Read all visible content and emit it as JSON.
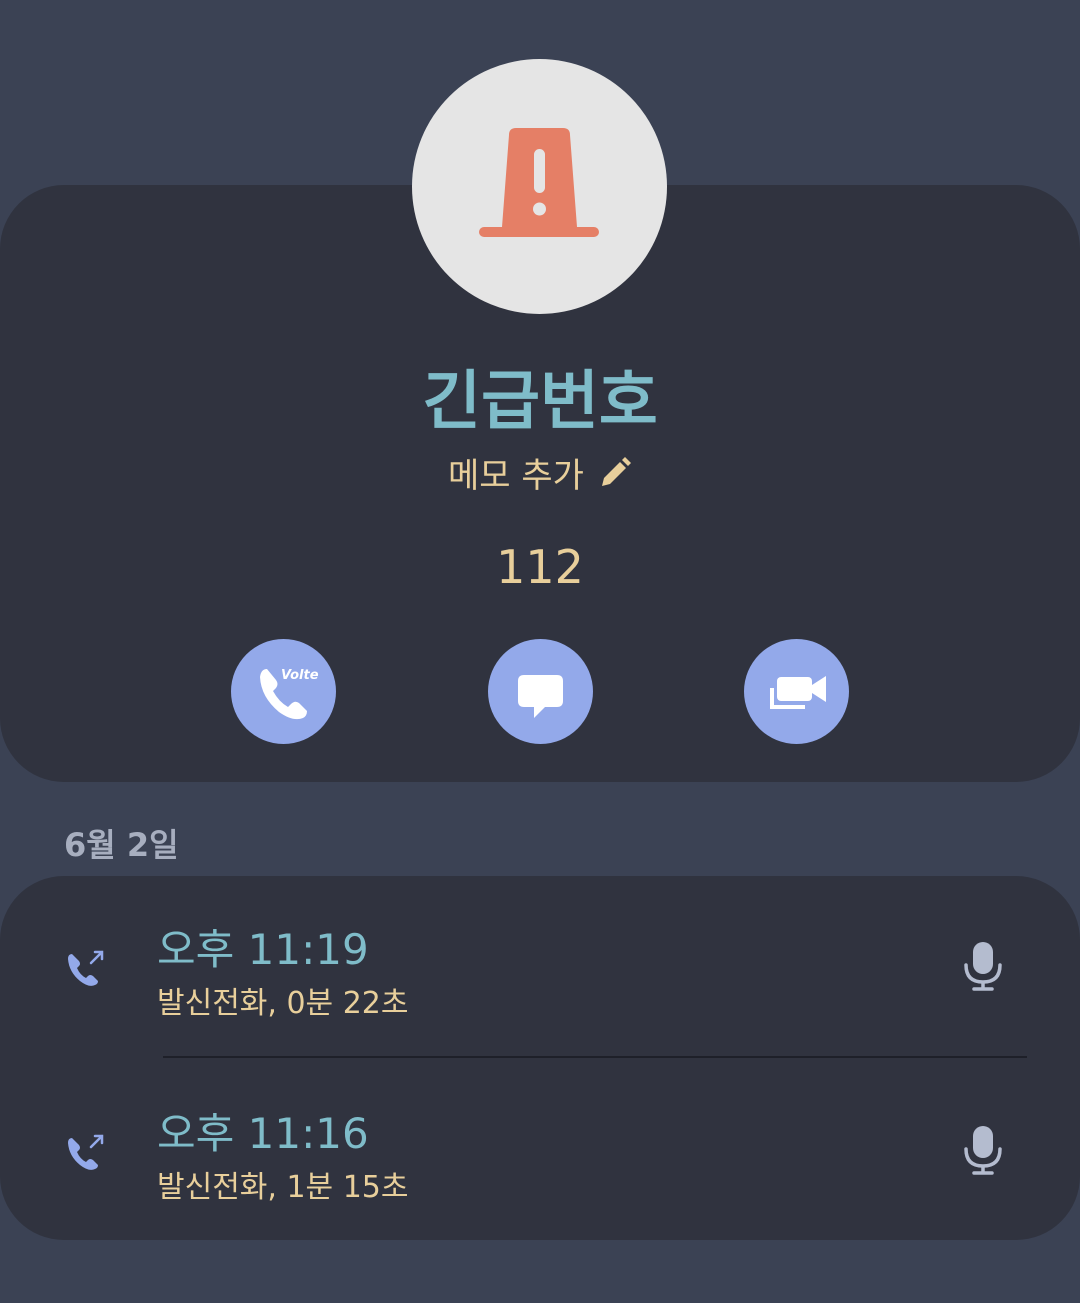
{
  "contact": {
    "name": "긴급번호",
    "memo_label": "메모 추가",
    "number": "112",
    "avatar_icon": "siren-icon",
    "avatar_color": "#e57f66"
  },
  "actions": [
    {
      "name": "voice-call",
      "icon": "phone-volte-icon",
      "badge": "Volte"
    },
    {
      "name": "message",
      "icon": "chat-bubble-icon"
    },
    {
      "name": "video-call",
      "icon": "video-camera-icon"
    }
  ],
  "history": {
    "date": "6월 2일",
    "entries": [
      {
        "time": "오후 11:19",
        "detail": "발신전화, 0분 22초",
        "icon": "outgoing-call-icon"
      },
      {
        "time": "오후 11:16",
        "detail": "발신전화, 1분 15초",
        "icon": "outgoing-call-icon"
      }
    ]
  },
  "colors": {
    "background": "#3b4254",
    "card": "#30333f",
    "accent_teal": "#7fbcc9",
    "accent_gold": "#e8cf9b",
    "action_blue": "#93a9ea"
  }
}
